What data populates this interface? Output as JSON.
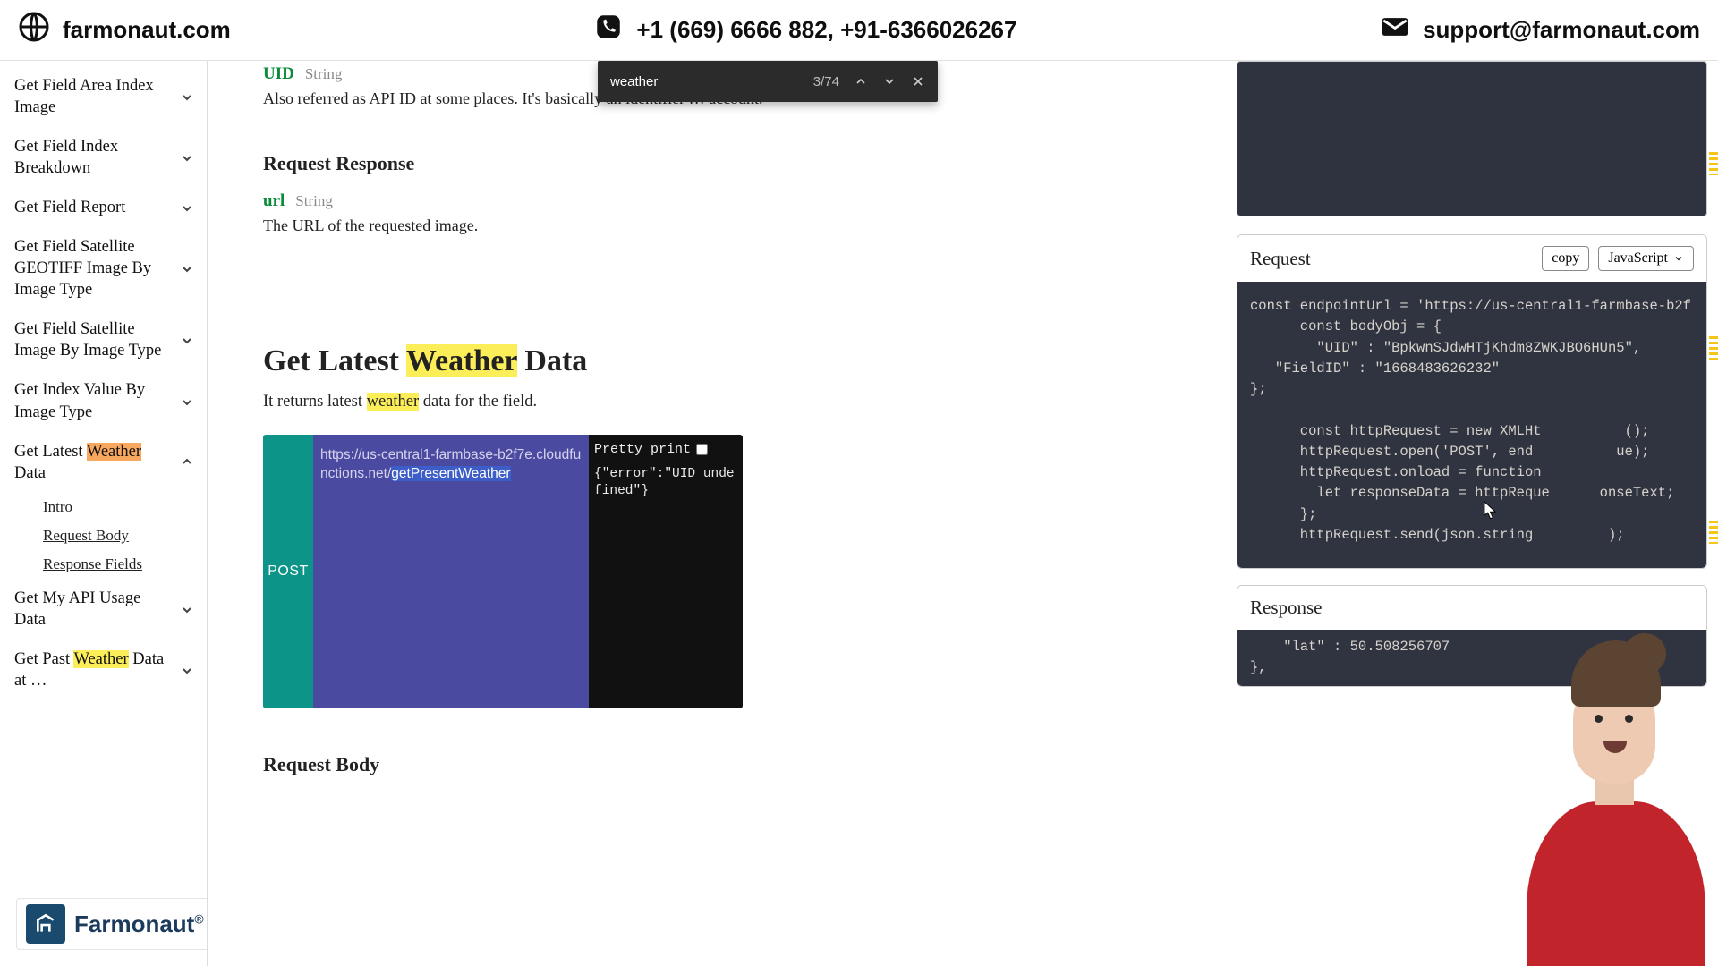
{
  "header": {
    "site": "farmonaut.com",
    "phone": "+1 (669) 6666 882, +91-6366026267",
    "email": "support@farmonaut.com"
  },
  "findbar": {
    "query": "weather",
    "count": "3/74"
  },
  "sidebar": {
    "items": [
      {
        "label": "Get Field Area Index Image"
      },
      {
        "label": "Get Field Index Breakdown"
      },
      {
        "label": "Get Field Report"
      },
      {
        "label": "Get Field Satellite GEOTIFF Image By Image Type"
      },
      {
        "label": "Get Field Satellite Image By Image Type"
      },
      {
        "label": "Get Index Value By Image Type"
      },
      {
        "label_pre": "Get Latest ",
        "label_hl": "Weather",
        "label_post": " Data",
        "active": true
      },
      {
        "label": "Get My API Usage Data"
      },
      {
        "label_pre": "Get Past ",
        "label_hl": "Weather",
        "label_post": " Data at …"
      }
    ],
    "sub": {
      "intro": "Intro",
      "reqbody": "Request Body",
      "respfields": "Response Fields"
    },
    "brand": "Farmonaut"
  },
  "content": {
    "uid_name": "UID",
    "uid_type": "String",
    "uid_desc": "Also referred as API ID at some places. It's basically an identifier … account.",
    "resp_head": "Request Response",
    "url_name": "url",
    "url_type": "String",
    "url_desc": "The URL of the requested image.",
    "title_pre": "Get Latest ",
    "title_hl": "Weather",
    "title_post": " Data",
    "desc_pre": "It returns latest ",
    "desc_hl": "weather",
    "desc_post": " data for the field.",
    "reqbody_head": "Request Body",
    "post": {
      "method": "POST",
      "url_a": "https://us-central1-farmbase-b2f7e.cloudfunctions.net/",
      "url_b": "getPresentWeather",
      "pp": "Pretty print",
      "resp": "{\"error\":\"UID undefined\"}"
    }
  },
  "right": {
    "req_title": "Request",
    "copy": "copy",
    "lang": "JavaScript",
    "code": "const endpointUrl = 'https://us-central1-farmbase-b2f\n      const bodyObj = {\n        \"UID\" : \"BpkwnSJdwHTjKhdm8ZWKJBO6HUn5\",\n   \"FieldID\" : \"1668483626232\"\n};\n\n      const httpRequest = new XMLHt          ();\n      httpRequest.open('POST', end          ue);\n      httpRequest.onload = function\n        let responseData = httpReque      onseText;\n      };\n      httpRequest.send(json.string         );",
    "resp_title": "Response",
    "resp_code": "    \"lat\" : 50.508256707\n},"
  }
}
